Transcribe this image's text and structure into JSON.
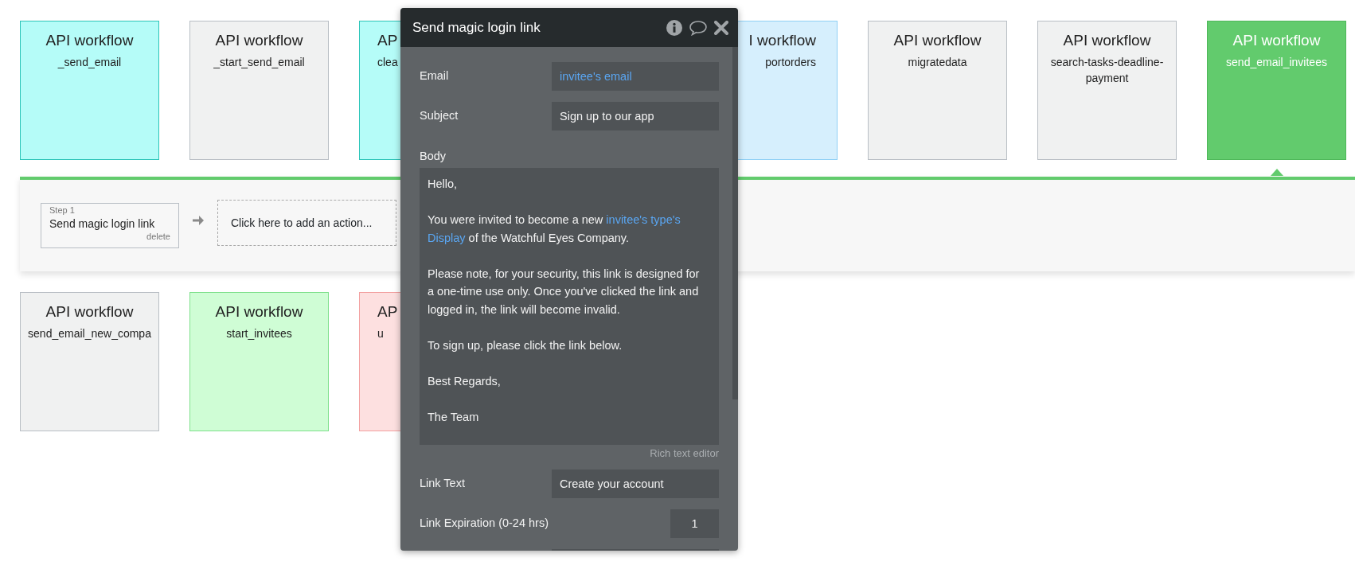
{
  "top_row": [
    {
      "kind": "whole",
      "title": "API workflow",
      "name": "_send_email",
      "color": "#b5fcf8",
      "selected": false
    },
    {
      "kind": "whole",
      "title": "API workflow",
      "name": "_start_send_email",
      "color": "#f0f1f1",
      "selected": false
    },
    {
      "kind": "coveredright",
      "title": "AP",
      "name": "clea",
      "color": "#b5fcf8",
      "selected": false
    },
    {
      "kind": "coveredleft",
      "title": "I workflow",
      "name": "portorders",
      "color": "#d6effd",
      "selected": false
    },
    {
      "kind": "whole",
      "title": "API workflow",
      "name": "migratedata",
      "color": "#f0f1f1",
      "selected": false
    },
    {
      "kind": "whole",
      "title": "API workflow",
      "name": "search-tasks-deadline-payment",
      "color": "#f0f1f1",
      "selected": false
    },
    {
      "kind": "whole",
      "title": "API workflow",
      "name": "send_email_invitees",
      "color": "#62cb6d",
      "selected": true
    }
  ],
  "steps": [
    {
      "label": "Step 1",
      "name": "Send magic login link",
      "delete": "delete"
    }
  ],
  "add_action": "Click here to add an action...",
  "bottom_row": [
    {
      "kind": "whole",
      "title": "API workflow",
      "name": "send_email_new_compa",
      "color": "#f0f1f1",
      "selected": false
    },
    {
      "kind": "whole",
      "title": "API workflow",
      "name": "start_invitees",
      "color": "#cffdd5",
      "selected": false
    },
    {
      "kind": "coveredright",
      "title": "AP",
      "name": "u",
      "color": "#fde0e0",
      "selected": false
    }
  ],
  "modal": {
    "title": "Send magic login link",
    "fields": [
      {
        "kind": "text",
        "label": "Email",
        "value": "invitee's email",
        "dynamic": true
      },
      {
        "kind": "text",
        "label": "Subject",
        "value": "Sign up to our app",
        "dynamic": false
      },
      {
        "kind": "richtext",
        "label": "Body",
        "hint": "Rich text editor",
        "paragraphs": [
          [
            {
              "text": "Hello,",
              "dynamic": false
            }
          ],
          [
            {
              "text": "You were invited  to become a new ",
              "dynamic": false
            },
            {
              "text": "invitee's type's Display",
              "dynamic": true
            },
            {
              "text": " of the Watchful Eyes Company.",
              "dynamic": false
            }
          ],
          [
            {
              "text": "Please note, for your security, this link is designed for a one-time use only. Once you've clicked the link and logged in, the link will become invalid.",
              "dynamic": false
            }
          ],
          [
            {
              "text": "To sign up, please click the link below.",
              "dynamic": false
            }
          ],
          [
            {
              "text": "Best Regards,",
              "dynamic": false
            }
          ],
          [
            {
              "text": "The Team",
              "dynamic": false
            }
          ]
        ]
      },
      {
        "kind": "text",
        "label": "Link Text",
        "value": "Create your account",
        "dynamic": false
      },
      {
        "kind": "number",
        "label": "Link Expiration (0-24 hrs)",
        "value": "1"
      },
      {
        "kind": "text"
      }
    ]
  }
}
